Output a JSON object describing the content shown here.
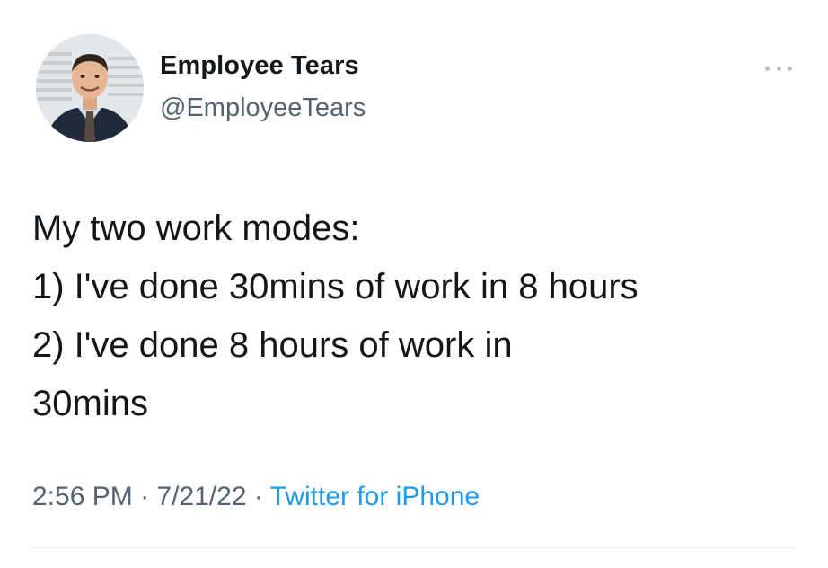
{
  "author": {
    "display_name": "Employee Tears",
    "handle": "@EmployeeTears",
    "avatar_icon": "profile-photo-man-in-suit"
  },
  "more_icon": "ellipsis-icon",
  "tweet": {
    "lines": [
      "My two work modes:",
      "1) I've done 30mins of work in 8 hours",
      "2) I've done 8 hours of work in",
      "30mins"
    ]
  },
  "meta": {
    "time": "2:56 PM",
    "separator": "·",
    "date": "7/21/22",
    "source": "Twitter for iPhone"
  },
  "colors": {
    "text": "#14171a",
    "secondary": "#536471",
    "link": "#1d9bf0"
  }
}
